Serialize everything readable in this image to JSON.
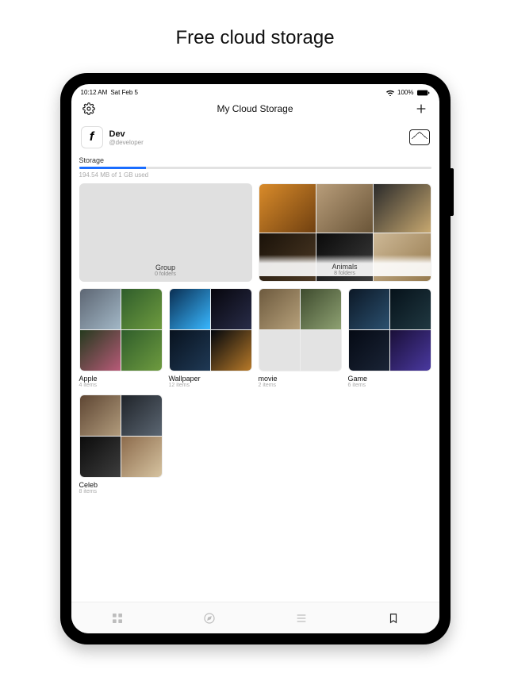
{
  "headline": "Free cloud storage",
  "statusbar": {
    "time": "10:12 AM",
    "date": "Sat Feb 5",
    "battery": "100%"
  },
  "navbar": {
    "title": "My Cloud Storage"
  },
  "user": {
    "avatar_letter": "f",
    "name": "Dev",
    "handle": "@developer"
  },
  "storage": {
    "section_label": "Storage",
    "used_text": "194.54 MB of 1 GB used",
    "percent": 19
  },
  "folders": {
    "group": {
      "name": "Group",
      "sub": "0 folders"
    },
    "animals": {
      "name": "Animals",
      "sub": "8 folders"
    },
    "apple": {
      "name": "Apple",
      "sub": "4 items"
    },
    "wallpaper": {
      "name": "Wallpaper",
      "sub": "12 items"
    },
    "movie": {
      "name": "movie",
      "sub": "2 items"
    },
    "game": {
      "name": "Game",
      "sub": "6 items"
    },
    "celeb": {
      "name": "Celeb",
      "sub": "8 items"
    }
  }
}
